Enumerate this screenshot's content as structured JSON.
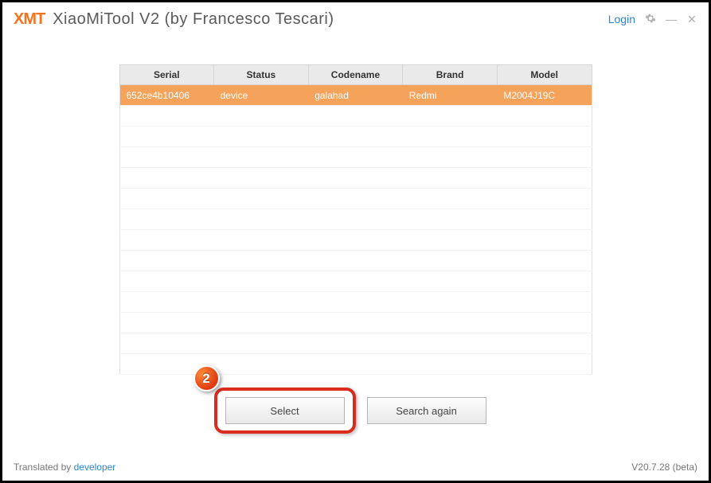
{
  "header": {
    "logo": "XMT",
    "title": "XiaoMiTool V2 (by Francesco Tescari)",
    "login": "Login"
  },
  "table": {
    "headers": {
      "serial": "Serial",
      "status": "Status",
      "codename": "Codename",
      "brand": "Brand",
      "model": "Model"
    },
    "rows": [
      {
        "serial": "652ce4b10406",
        "status": "device",
        "codename": "galahad",
        "brand": "Redmi",
        "model": "M2004J19C"
      }
    ],
    "empty_rows": 13
  },
  "buttons": {
    "select": "Select",
    "search_again": "Search again"
  },
  "annotation": {
    "badge": "2"
  },
  "footer": {
    "translated_by": "Translated by ",
    "developer": "developer",
    "version": "V20.7.28 (beta)"
  }
}
